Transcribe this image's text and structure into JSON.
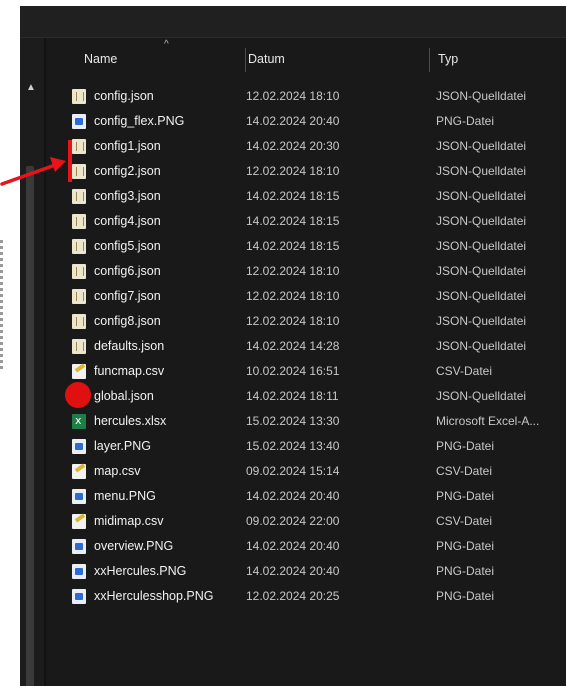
{
  "header": {
    "name_label": "Name",
    "date_label": "Datum",
    "type_label": "Typ"
  },
  "rows": [
    {
      "name": "config.json",
      "date": "12.02.2024 18:10",
      "type": "JSON-Quelldatei",
      "icon": "json-file-icon"
    },
    {
      "name": "config_flex.PNG",
      "date": "14.02.2024 20:40",
      "type": "PNG-Datei",
      "icon": "png-file-icon"
    },
    {
      "name": "config1.json",
      "date": "14.02.2024 20:30",
      "type": "JSON-Quelldatei",
      "icon": "json-file-icon"
    },
    {
      "name": "config2.json",
      "date": "12.02.2024 18:10",
      "type": "JSON-Quelldatei",
      "icon": "json-file-icon"
    },
    {
      "name": "config3.json",
      "date": "14.02.2024 18:15",
      "type": "JSON-Quelldatei",
      "icon": "json-file-icon"
    },
    {
      "name": "config4.json",
      "date": "14.02.2024 18:15",
      "type": "JSON-Quelldatei",
      "icon": "json-file-icon"
    },
    {
      "name": "config5.json",
      "date": "14.02.2024 18:15",
      "type": "JSON-Quelldatei",
      "icon": "json-file-icon"
    },
    {
      "name": "config6.json",
      "date": "12.02.2024 18:10",
      "type": "JSON-Quelldatei",
      "icon": "json-file-icon"
    },
    {
      "name": "config7.json",
      "date": "12.02.2024 18:10",
      "type": "JSON-Quelldatei",
      "icon": "json-file-icon"
    },
    {
      "name": "config8.json",
      "date": "12.02.2024 18:10",
      "type": "JSON-Quelldatei",
      "icon": "json-file-icon"
    },
    {
      "name": "defaults.json",
      "date": "14.02.2024 14:28",
      "type": "JSON-Quelldatei",
      "icon": "json-file-icon"
    },
    {
      "name": "funcmap.csv",
      "date": "10.02.2024 16:51",
      "type": "CSV-Datei",
      "icon": "csv-file-icon"
    },
    {
      "name": "global.json",
      "date": "14.02.2024 18:11",
      "type": "JSON-Quelldatei",
      "icon": "json-file-icon"
    },
    {
      "name": "hercules.xlsx",
      "date": "15.02.2024 13:30",
      "type": "Microsoft Excel-A...",
      "icon": "excel-file-icon"
    },
    {
      "name": "layer.PNG",
      "date": "15.02.2024 13:40",
      "type": "PNG-Datei",
      "icon": "png-file-icon"
    },
    {
      "name": "map.csv",
      "date": "09.02.2024 15:14",
      "type": "CSV-Datei",
      "icon": "csv-file-icon"
    },
    {
      "name": "menu.PNG",
      "date": "14.02.2024 20:40",
      "type": "PNG-Datei",
      "icon": "png-file-icon"
    },
    {
      "name": "midimap.csv",
      "date": "09.02.2024 22:00",
      "type": "CSV-Datei",
      "icon": "csv-file-icon"
    },
    {
      "name": "overview.PNG",
      "date": "14.02.2024 20:40",
      "type": "PNG-Datei",
      "icon": "png-file-icon"
    },
    {
      "name": "xxHercules.PNG",
      "date": "14.02.2024 20:40",
      "type": "PNG-Datei",
      "icon": "png-file-icon"
    },
    {
      "name": "xxHerculesshop.PNG",
      "date": "12.02.2024 20:25",
      "type": "PNG-Datei",
      "icon": "png-file-icon"
    }
  ],
  "colors": {
    "background": "#191919",
    "text": "#f2f2f2",
    "muted_text": "#c8c8c8",
    "annotation_red": "#e8141a"
  }
}
